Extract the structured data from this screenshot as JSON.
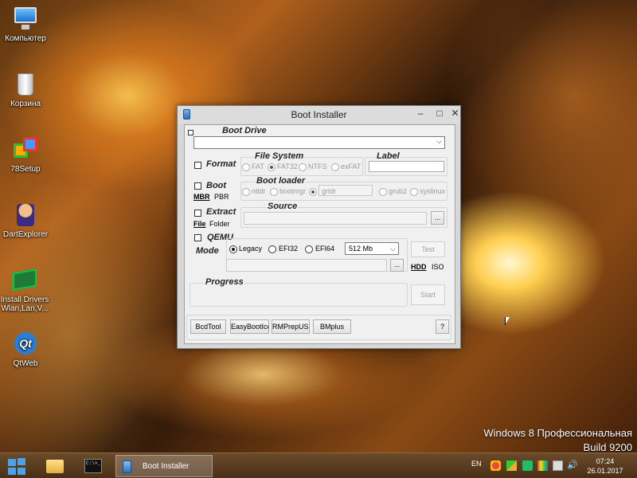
{
  "desktop": {
    "icons": [
      {
        "label": "Компьютер",
        "icon": "computer-icon"
      },
      {
        "label": "Корзина",
        "icon": "recycle-bin-icon"
      },
      {
        "label": "78Setup",
        "icon": "setup-icon"
      },
      {
        "label": "DartExplorer",
        "icon": "dart-explorer-icon"
      },
      {
        "label": "Install Drivers Wlan,Lan,V...",
        "icon": "drivers-icon"
      },
      {
        "label": "QtWeb",
        "icon": "qtweb-icon"
      }
    ],
    "watermark_line1": "Windows 8 Профессиональная",
    "watermark_line2": "Build 9200"
  },
  "window": {
    "title": "Boot Installer",
    "minimize_glyph": "–",
    "maximize_glyph": "□",
    "close_glyph": "✕",
    "boot_drive": {
      "label": "Boot Drive",
      "value": ""
    },
    "format": {
      "label": "Format",
      "file_system_label": "File System",
      "options": [
        "FAT",
        "FAT32",
        "NTFS",
        "exFAT"
      ],
      "selected": "FAT32",
      "label_field_label": "Label",
      "label_value": ""
    },
    "boot": {
      "label": "Boot",
      "mbr": "MBR",
      "pbr": "PBR",
      "loader_label": "Boot loader",
      "options": [
        "ntldr",
        "bootmgr",
        "grldr",
        "grub2",
        "syslinux"
      ],
      "selected": "grldr"
    },
    "extract": {
      "label": "Extract",
      "file": "File",
      "folder": "Folder",
      "source_label": "Source",
      "source_value": "",
      "browse": "..."
    },
    "qemu": {
      "label": "QEMU",
      "mode_label": "Mode",
      "modes": [
        "Legacy",
        "EFI32",
        "EFI64"
      ],
      "selected_mode": "Legacy",
      "memory": "512 Mb",
      "path_value": "",
      "browse": "...",
      "test": "Test",
      "hdd": "HDD",
      "iso": "ISO"
    },
    "progress": {
      "label": "Progress",
      "start": "Start"
    },
    "bottom_buttons": [
      "BcdTool",
      "EasyBootIce",
      "RMPrepUSB",
      "BMplus"
    ],
    "help": "?"
  },
  "taskbar": {
    "active_app": "Boot Installer",
    "cmd_text": "C:\\>_",
    "language": "EN",
    "time": "07:24",
    "date": "26.01.2017"
  },
  "colors": {
    "window_bg": "#f0f0f0",
    "title_bg": "#dcdcdc",
    "start_blue": "#4aa3e8",
    "taskbar": "#5a3c1e"
  }
}
